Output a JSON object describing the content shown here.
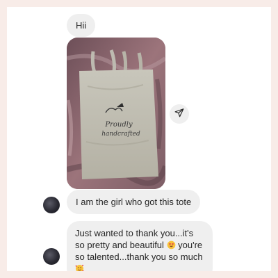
{
  "messages": {
    "greeting": "Hii",
    "tote": "I am the girl who got this tote",
    "thanks_part1": "Just wanted to thank you...it's so pretty and beautiful ",
    "thanks_part2": " you're so talented...thank you so much "
  },
  "photo": {
    "bag_print_line1": "Proudly",
    "bag_print_line2": "handcrafted"
  },
  "icons": {
    "share": "paper-plane-icon",
    "emoji_1": "heart-eyes-emoji",
    "emoji_2": "smiling-face-with-hearts-emoji"
  },
  "colors": {
    "page_background": "#f8ece8",
    "bubble": "#efefef",
    "text": "#262626"
  }
}
